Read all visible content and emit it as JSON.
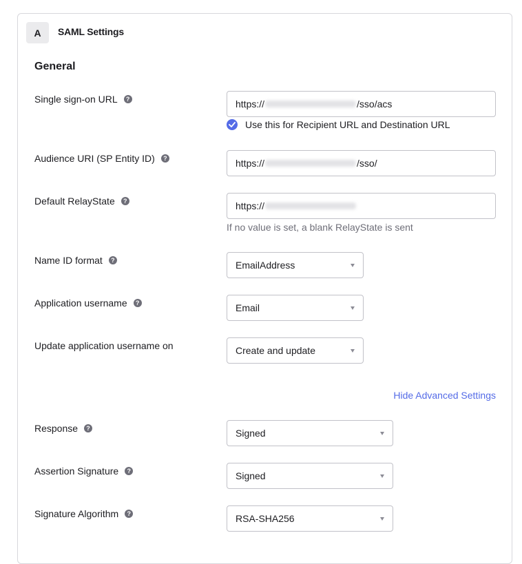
{
  "card": {
    "step_letter": "A",
    "title": "SAML Settings"
  },
  "section": {
    "title": "General"
  },
  "fields": {
    "sso_url": {
      "label": "Single sign-on URL",
      "value_prefix": "https://",
      "value_suffix": "/sso/acs",
      "checkbox_label": "Use this for Recipient URL and Destination URL",
      "checkbox_checked": true
    },
    "audience_uri": {
      "label": "Audience URI (SP Entity ID)",
      "value_prefix": "https://",
      "value_suffix": "/sso/"
    },
    "relay_state": {
      "label": "Default RelayState",
      "value_prefix": "https://",
      "value_suffix": "",
      "hint": "If no value is set, a blank RelayState is sent"
    },
    "name_id_format": {
      "label": "Name ID format",
      "selected": "EmailAddress"
    },
    "app_username": {
      "label": "Application username",
      "selected": "Email"
    },
    "update_username_on": {
      "label": "Update application username on",
      "selected": "Create and update"
    }
  },
  "advanced_link": "Hide Advanced Settings",
  "advanced": {
    "response": {
      "label": "Response",
      "selected": "Signed"
    },
    "assertion_signature": {
      "label": "Assertion Signature",
      "selected": "Signed"
    },
    "signature_algorithm": {
      "label": "Signature Algorithm",
      "selected": "RSA-SHA256"
    }
  },
  "icons": {
    "help": "?",
    "check": "checkmark-icon",
    "caret": "caret-down-icon"
  },
  "colors": {
    "accent": "#546be7",
    "help_icon": "#6e6e78",
    "hint_text": "#6e6e78",
    "border": "#c1c1c8"
  }
}
